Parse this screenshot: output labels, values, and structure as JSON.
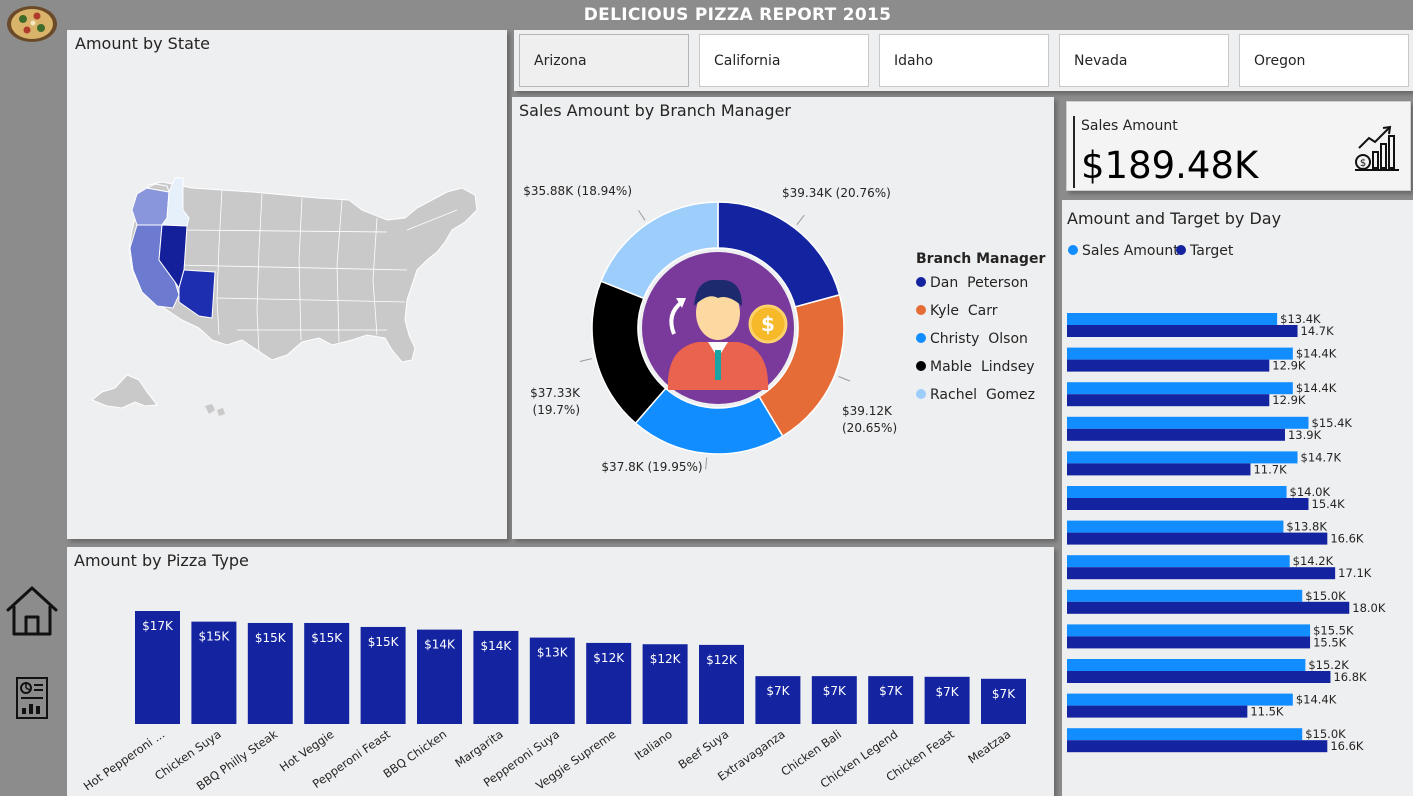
{
  "report": {
    "title": "DELICIOUS PIZZA REPORT 2015"
  },
  "colors": {
    "dark_blue": "#1424a0",
    "mid_blue": "#118dff",
    "orange": "#e66c37",
    "black": "#000000",
    "light_blue": "#9dcefb",
    "purple": "#7a3a9c",
    "panel_bg": "#eeeff1"
  },
  "icons": {
    "home": "home-icon",
    "report": "report-icon",
    "kpi": "sales-chart-icon",
    "logo": "pizza-logo"
  },
  "map_panel": {
    "title": "Amount by State",
    "highlighted_states": [
      "Arizona",
      "California",
      "Idaho",
      "Nevada",
      "Oregon"
    ]
  },
  "state_slicer": {
    "options": [
      "Arizona",
      "California",
      "Idaho",
      "Nevada",
      "Oregon"
    ],
    "selected": "Arizona"
  },
  "donut_panel": {
    "title": "Sales Amount by Branch Manager",
    "legend_title": "Branch Manager"
  },
  "kpi": {
    "label": "Sales Amount",
    "value": "$189.48K"
  },
  "day_panel": {
    "title": "Amount and Target by Day"
  },
  "pizza_panel": {
    "title": "Amount by Pizza Type"
  },
  "chart_data": [
    {
      "type": "pie",
      "title": "Sales Amount by Branch Manager",
      "legend_title": "Branch Manager",
      "legend_position": "right",
      "slices": [
        {
          "name": "Dan  Peterson",
          "value": 39.34,
          "label": "$39.34K (20.76%)",
          "color": "#1424a0"
        },
        {
          "name": "Kyle  Carr",
          "value": 39.12,
          "label": "$39.12K (20.65%)",
          "color": "#e66c37"
        },
        {
          "name": "Christy  Olson",
          "value": 37.8,
          "label": "$37.8K (19.95%)",
          "color": "#118dff"
        },
        {
          "name": "Mable  Lindsey",
          "value": 37.33,
          "label": "$37.33K (19.7%)",
          "color": "#000000"
        },
        {
          "name": "Rachel  Gomez",
          "value": 35.88,
          "label": "$35.88K (18.94%)",
          "color": "#9dcefb"
        }
      ]
    },
    {
      "type": "bar",
      "orientation": "horizontal",
      "title": "Amount and Target by Day",
      "legend_position": "top-left",
      "series": [
        {
          "name": "Sales Amount",
          "color": "#118dff",
          "values": [
            13.4,
            14.4,
            14.4,
            15.4,
            14.7,
            14.0,
            13.8,
            14.2,
            15.0,
            15.5,
            15.2,
            14.4,
            15.0
          ],
          "labels": [
            "$13.4K",
            "$14.4K",
            "$14.4K",
            "$15.4K",
            "$14.7K",
            "$14.0K",
            "$13.8K",
            "$14.2K",
            "$15.0K",
            "$15.5K",
            "$15.2K",
            "$14.4K",
            "$15.0K"
          ]
        },
        {
          "name": "Target",
          "color": "#1424a0",
          "values": [
            14.7,
            12.9,
            12.9,
            13.9,
            11.7,
            15.4,
            16.6,
            17.1,
            18.0,
            15.5,
            16.8,
            11.5,
            16.6
          ],
          "labels": [
            "14.7K",
            "12.9K",
            "12.9K",
            "13.9K",
            "11.7K",
            "15.4K",
            "16.6K",
            "17.1K",
            "18.0K",
            "15.5K",
            "16.8K",
            "11.5K",
            "16.6K"
          ]
        }
      ],
      "xlim": [
        0,
        22
      ]
    },
    {
      "type": "bar",
      "title": "Amount by Pizza Type",
      "categories": [
        "Hot Pepperoni ...",
        "Chicken Suya",
        "BBQ Philly Steak",
        "Hot Veggie",
        "Pepperoni Feast",
        "BBQ Chicken",
        "Margarita",
        "Pepperoni Suya",
        "Veggie Supreme",
        "Italiano",
        "Beef Suya",
        "Extravaganza",
        "Chicken Bali",
        "Chicken Legend",
        "Chicken Feast",
        "Meatzaa"
      ],
      "values": [
        17.0,
        15.4,
        15.2,
        15.2,
        14.6,
        14.2,
        14.0,
        13.0,
        12.2,
        12.0,
        11.9,
        7.2,
        7.2,
        7.2,
        7.1,
        6.8
      ],
      "labels": [
        "$17K",
        "$15K",
        "$15K",
        "$15K",
        "$15K",
        "$14K",
        "$14K",
        "$13K",
        "$12K",
        "$12K",
        "$12K",
        "$7K",
        "$7K",
        "$7K",
        "$7K",
        "$7K"
      ],
      "color": "#1424a0",
      "ylim": [
        0,
        17.5
      ]
    }
  ]
}
